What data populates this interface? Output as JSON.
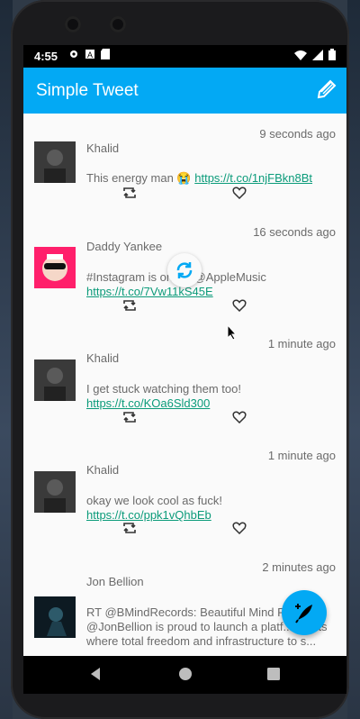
{
  "status": {
    "time": "4:55",
    "left_icons": [
      "gear-icon",
      "a-icon",
      "sd-icon"
    ],
    "right_icons": [
      "wifi-icon",
      "signal-icon",
      "battery-icon"
    ]
  },
  "app": {
    "title": "Simple Tweet",
    "compose_icon": "pencil-icon"
  },
  "tweets": [
    {
      "name": "Khalid",
      "time": "9 seconds ago",
      "text": "This energy man 😭 ",
      "link": "https://t.co/1njFBkn8Bt"
    },
    {
      "name": "Daddy Yankee",
      "time": "16 seconds ago",
      "text": "#Instagram is on 🔥 @AppleMusic",
      "link": "https://t.co/7Vw11kS45E"
    },
    {
      "name": "Khalid",
      "time": "1 minute ago",
      "text": "I get stuck watching them too!",
      "link": "https://t.co/KOa6Sld300"
    },
    {
      "name": "Khalid",
      "time": "1 minute ago",
      "text": "okay we look cool as fuck!",
      "link": "https://t.co/ppk1vQhbEb"
    },
    {
      "name": "Jon Bellion",
      "time": "2 minutes ago",
      "text": "RT @BMindRecords: Beautiful Mind R... @JonBellion is proud to launch a platf... artists where total freedom and infrastructure to s..."
    }
  ],
  "colors": {
    "primary": "#03a9f4",
    "link": "#0b9b7a",
    "text": "#6b6b6b"
  }
}
